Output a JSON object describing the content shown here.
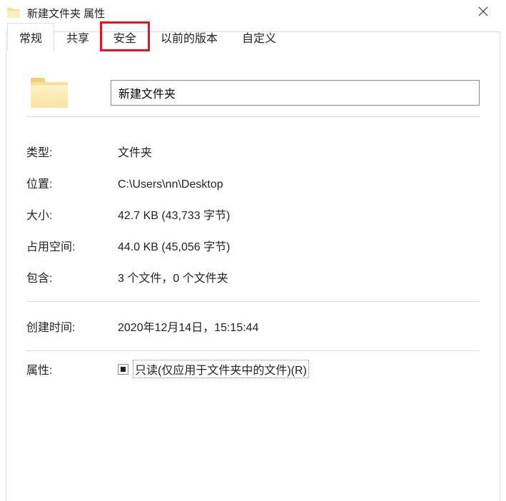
{
  "window": {
    "title": "新建文件夹 属性"
  },
  "tabs": {
    "general": "常规",
    "sharing": "共享",
    "security": "安全",
    "previous": "以前的版本",
    "custom": "自定义"
  },
  "folder": {
    "name": "新建文件夹"
  },
  "labels": {
    "type": "类型:",
    "location": "位置:",
    "size": "大小:",
    "size_on_disk": "占用空间:",
    "contains": "包含:",
    "created": "创建时间:",
    "attributes": "属性:"
  },
  "values": {
    "type": "文件夹",
    "location": "C:\\Users\\nn\\Desktop",
    "size": "42.7 KB (43,733 字节)",
    "size_on_disk": "44.0 KB (45,056 字节)",
    "contains": "3 个文件，0 个文件夹",
    "created": "2020年12月14日，15:15:44"
  },
  "attributes": {
    "readonly_label": "只读(仅应用于文件夹中的文件)(R)",
    "readonly_state": "indeterminate"
  }
}
